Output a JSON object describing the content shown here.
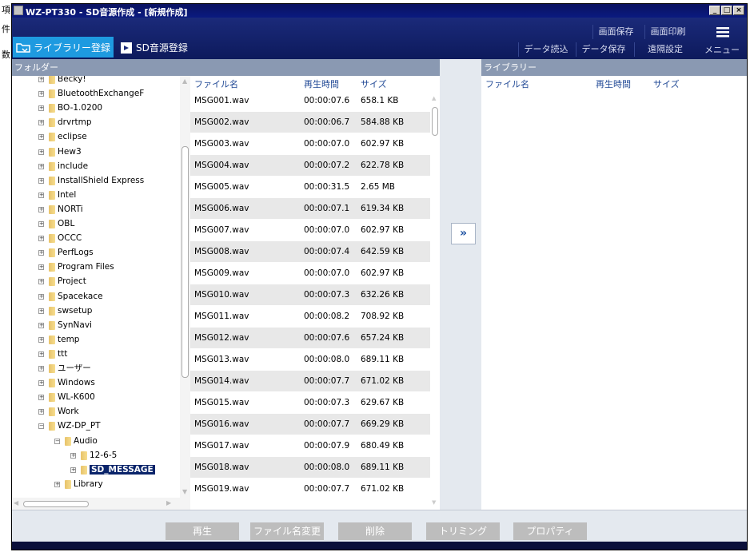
{
  "stray_text": [
    "項",
    "件",
    "数"
  ],
  "window": {
    "title": "WZ-PT330 - SD音源作成 - [新規作成]",
    "minimize": "_",
    "restore": "□",
    "close": "×"
  },
  "toolbar": {
    "tab_library": "ライブラリー登録",
    "tab_sd": "SD音源登録",
    "screen_save": "画面保存",
    "screen_print": "画面印刷",
    "data_load": "データ読込",
    "data_save": "データ保存",
    "remote_settings": "遠隔設定",
    "menu": "メニュー"
  },
  "folder_header": "フォルダー",
  "library_header": "ライブラリー",
  "tree": [
    {
      "label": "Becky!",
      "indent": 0,
      "box": "+"
    },
    {
      "label": "BluetoothExchangeF",
      "indent": 0,
      "box": "+"
    },
    {
      "label": "BO-1.0200",
      "indent": 0,
      "box": "+"
    },
    {
      "label": "drvrtmp",
      "indent": 0,
      "box": "+"
    },
    {
      "label": "eclipse",
      "indent": 0,
      "box": "+"
    },
    {
      "label": "Hew3",
      "indent": 0,
      "box": "+"
    },
    {
      "label": "include",
      "indent": 0,
      "box": "+"
    },
    {
      "label": "InstallShield Express",
      "indent": 0,
      "box": "+"
    },
    {
      "label": "Intel",
      "indent": 0,
      "box": "+"
    },
    {
      "label": "NORTi",
      "indent": 0,
      "box": "+"
    },
    {
      "label": "OBL",
      "indent": 0,
      "box": "+"
    },
    {
      "label": "OCCC",
      "indent": 0,
      "box": "+"
    },
    {
      "label": "PerfLogs",
      "indent": 0,
      "box": "+"
    },
    {
      "label": "Program Files",
      "indent": 0,
      "box": "+"
    },
    {
      "label": "Project",
      "indent": 0,
      "box": "+"
    },
    {
      "label": "Spacekace",
      "indent": 0,
      "box": "+"
    },
    {
      "label": "swsetup",
      "indent": 0,
      "box": "+"
    },
    {
      "label": "SynNavi",
      "indent": 0,
      "box": "+"
    },
    {
      "label": "temp",
      "indent": 0,
      "box": "+"
    },
    {
      "label": "ttt",
      "indent": 0,
      "box": "+"
    },
    {
      "label": "ユーザー",
      "indent": 0,
      "box": "+"
    },
    {
      "label": "Windows",
      "indent": 0,
      "box": "+"
    },
    {
      "label": "WL-K600",
      "indent": 0,
      "box": "+"
    },
    {
      "label": "Work",
      "indent": 0,
      "box": "+"
    },
    {
      "label": "WZ-DP_PT",
      "indent": 0,
      "box": "−"
    },
    {
      "label": "Audio",
      "indent": 1,
      "box": "−"
    },
    {
      "label": "12-6-5",
      "indent": 2,
      "box": "+"
    },
    {
      "label": "SD_MESSAGE",
      "indent": 2,
      "box": "+",
      "selected": true
    },
    {
      "label": "Library",
      "indent": 1,
      "box": "+"
    }
  ],
  "filelist": {
    "columns": [
      "ファイル名",
      "再生時間",
      "サイズ"
    ],
    "rows": [
      [
        "MSG001.wav",
        "00:00:07.6",
        "658.1 KB"
      ],
      [
        "MSG002.wav",
        "00:00:06.7",
        "584.88 KB"
      ],
      [
        "MSG003.wav",
        "00:00:07.0",
        "602.97 KB"
      ],
      [
        "MSG004.wav",
        "00:00:07.2",
        "622.78 KB"
      ],
      [
        "MSG005.wav",
        "00:00:31.5",
        "2.65 MB"
      ],
      [
        "MSG006.wav",
        "00:00:07.1",
        "619.34 KB"
      ],
      [
        "MSG007.wav",
        "00:00:07.0",
        "602.97 KB"
      ],
      [
        "MSG008.wav",
        "00:00:07.4",
        "642.59 KB"
      ],
      [
        "MSG009.wav",
        "00:00:07.0",
        "602.97 KB"
      ],
      [
        "MSG010.wav",
        "00:00:07.3",
        "632.26 KB"
      ],
      [
        "MSG011.wav",
        "00:00:08.2",
        "708.92 KB"
      ],
      [
        "MSG012.wav",
        "00:00:07.6",
        "657.24 KB"
      ],
      [
        "MSG013.wav",
        "00:00:08.0",
        "689.11 KB"
      ],
      [
        "MSG014.wav",
        "00:00:07.7",
        "671.02 KB"
      ],
      [
        "MSG015.wav",
        "00:00:07.3",
        "629.67 KB"
      ],
      [
        "MSG016.wav",
        "00:00:07.7",
        "669.29 KB"
      ],
      [
        "MSG017.wav",
        "00:00:07.9",
        "680.49 KB"
      ],
      [
        "MSG018.wav",
        "00:00:08.0",
        "689.11 KB"
      ],
      [
        "MSG019.wav",
        "00:00:07.7",
        "671.02 KB"
      ]
    ]
  },
  "transfer_button": "»",
  "library": {
    "columns": [
      "ファイル名",
      "再生時間",
      "サイズ"
    ]
  },
  "bottom_buttons": {
    "play": "再生",
    "rename": "ファイル名変更",
    "delete": "削除",
    "trimming": "トリミング",
    "properties": "プロパティ"
  },
  "colors": {
    "window_bg": "#0a0f3a",
    "tab_active": "#1e9ae0",
    "header_bar": "#8a99b2",
    "column_header_text": "#224a96",
    "row_alt": "#e8e8e8",
    "selection": "#0a246a",
    "button_disabled": "#bdbdbd"
  }
}
